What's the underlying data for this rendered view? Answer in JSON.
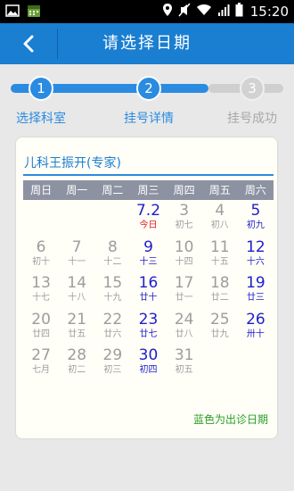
{
  "status_bar": {
    "time": "15:20",
    "left_icons": [
      "image-icon",
      "calendar-app-icon"
    ],
    "right_icons": [
      "location-icon",
      "mute-icon",
      "wifi-icon",
      "signal-icon",
      "battery-icon"
    ]
  },
  "header": {
    "back_icon": "chevron-left-icon",
    "title": "请选择日期"
  },
  "steps": [
    {
      "num": "1",
      "label": "选择科室",
      "state": "done"
    },
    {
      "num": "2",
      "label": "挂号详情",
      "state": "current"
    },
    {
      "num": "3",
      "label": "挂号成功",
      "state": "pending"
    }
  ],
  "calendar": {
    "doctor": "儿科王振开(专家)",
    "weekdays": [
      "周日",
      "周一",
      "周二",
      "周三",
      "周四",
      "周五",
      "周六"
    ],
    "days": [
      {
        "d": "",
        "s": "",
        "st": "blank"
      },
      {
        "d": "",
        "s": "",
        "st": "blank"
      },
      {
        "d": "",
        "s": "",
        "st": "blank"
      },
      {
        "d": "7.2",
        "s": "今日",
        "st": "today"
      },
      {
        "d": "3",
        "s": "初七",
        "st": "normal"
      },
      {
        "d": "4",
        "s": "初八",
        "st": "normal"
      },
      {
        "d": "5",
        "s": "初九",
        "st": "avail"
      },
      {
        "d": "6",
        "s": "初十",
        "st": "normal"
      },
      {
        "d": "7",
        "s": "十一",
        "st": "normal"
      },
      {
        "d": "8",
        "s": "十二",
        "st": "normal"
      },
      {
        "d": "9",
        "s": "十三",
        "st": "avail"
      },
      {
        "d": "10",
        "s": "十四",
        "st": "normal"
      },
      {
        "d": "11",
        "s": "十五",
        "st": "normal"
      },
      {
        "d": "12",
        "s": "十六",
        "st": "avail"
      },
      {
        "d": "13",
        "s": "十七",
        "st": "normal"
      },
      {
        "d": "14",
        "s": "十八",
        "st": "normal"
      },
      {
        "d": "15",
        "s": "十九",
        "st": "normal"
      },
      {
        "d": "16",
        "s": "廿十",
        "st": "avail"
      },
      {
        "d": "17",
        "s": "廿一",
        "st": "normal"
      },
      {
        "d": "18",
        "s": "廿二",
        "st": "normal"
      },
      {
        "d": "19",
        "s": "廿三",
        "st": "avail"
      },
      {
        "d": "20",
        "s": "廿四",
        "st": "normal"
      },
      {
        "d": "21",
        "s": "廿五",
        "st": "normal"
      },
      {
        "d": "22",
        "s": "廿六",
        "st": "normal"
      },
      {
        "d": "23",
        "s": "廿七",
        "st": "avail"
      },
      {
        "d": "24",
        "s": "廿八",
        "st": "normal"
      },
      {
        "d": "25",
        "s": "廿九",
        "st": "normal"
      },
      {
        "d": "26",
        "s": "卅十",
        "st": "avail"
      },
      {
        "d": "27",
        "s": "七月",
        "st": "normal"
      },
      {
        "d": "28",
        "s": "初二",
        "st": "normal"
      },
      {
        "d": "29",
        "s": "初三",
        "st": "normal"
      },
      {
        "d": "30",
        "s": "初四",
        "st": "avail"
      },
      {
        "d": "31",
        "s": "初五",
        "st": "normal"
      }
    ],
    "note": "蓝色为出诊日期"
  },
  "colors": {
    "header": "#1a7ed1",
    "accent": "#2b8be0",
    "available": "#1e1ecc",
    "today": "#e21b1b",
    "note": "#28a024"
  }
}
